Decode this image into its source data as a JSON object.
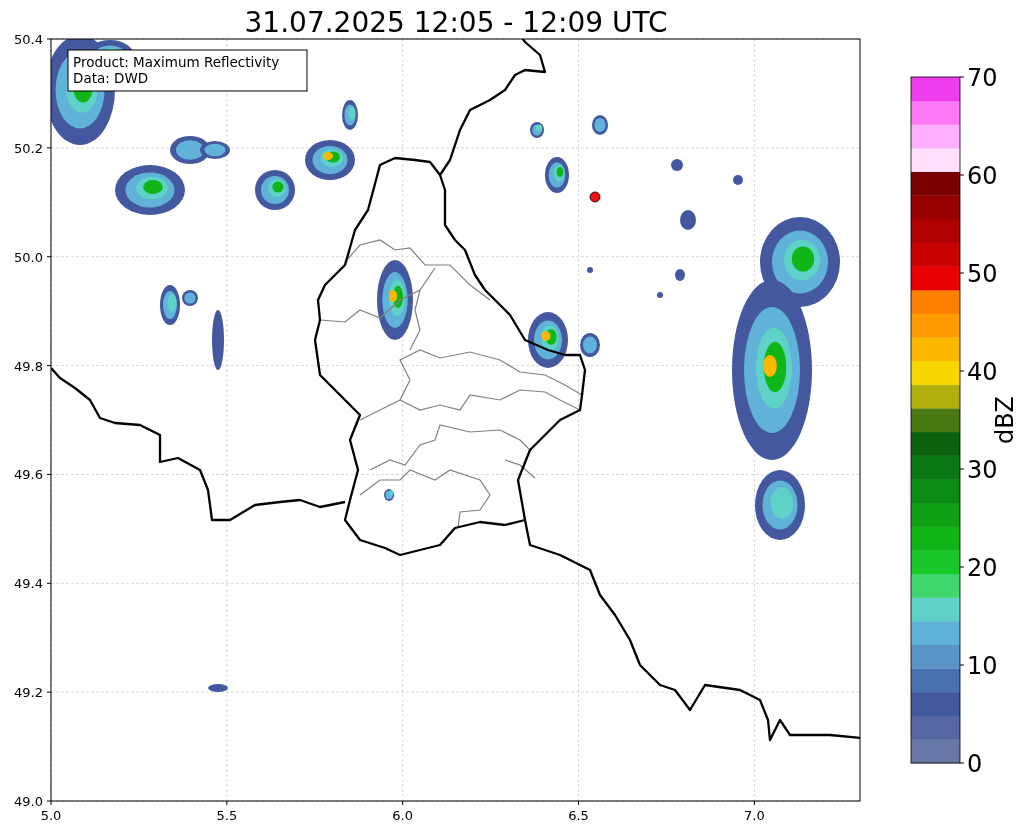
{
  "title": "31.07.2025 12:05 - 12:09 UTC",
  "legend": [
    "Product: Maximum Reflectivity",
    "Data: DWD"
  ],
  "x_axis": {
    "ticks": [
      "5.0",
      "5.5",
      "6.0",
      "6.5",
      "7.0"
    ]
  },
  "y_axis": {
    "ticks": [
      "50.4",
      "50.2",
      "50.0",
      "49.8",
      "49.6",
      "49.4",
      "49.2",
      "49.0"
    ]
  },
  "colorbar": {
    "label": "dBZ",
    "ticks": [
      "70",
      "60",
      "50",
      "40",
      "30",
      "20",
      "10",
      "0"
    ],
    "levels": [
      {
        "color": "#6677a8"
      },
      {
        "color": "#5566a2"
      },
      {
        "color": "#4458a0"
      },
      {
        "color": "#4a72b0"
      },
      {
        "color": "#5a94c6"
      },
      {
        "color": "#60b2d8"
      },
      {
        "color": "#5ed2c6"
      },
      {
        "color": "#40d670"
      },
      {
        "color": "#18c828"
      },
      {
        "color": "#10b618"
      },
      {
        "color": "#10a014"
      },
      {
        "color": "#0b8a14"
      },
      {
        "color": "#0a7812"
      },
      {
        "color": "#0a620e"
      },
      {
        "color": "#4a7812"
      },
      {
        "color": "#b0b010"
      },
      {
        "color": "#f8d800"
      },
      {
        "color": "#ffb800"
      },
      {
        "color": "#ff9c00"
      },
      {
        "color": "#ff8000"
      },
      {
        "color": "#e80000"
      },
      {
        "color": "#c80000"
      },
      {
        "color": "#b00000"
      },
      {
        "color": "#980000"
      },
      {
        "color": "#780000"
      },
      {
        "color": "#ffe0ff"
      },
      {
        "color": "#ffb0ff"
      },
      {
        "color": "#ff78f8"
      },
      {
        "color": "#ee3cee"
      }
    ]
  }
}
